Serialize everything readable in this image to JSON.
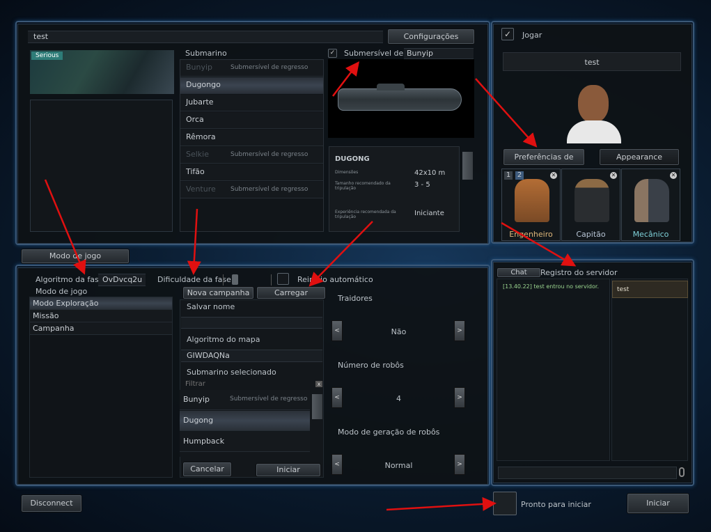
{
  "server": {
    "name": "test",
    "settings_label": "Configurações",
    "mode_badge": "Serious"
  },
  "submarine": {
    "label": "Submarino",
    "items": [
      {
        "name": "Bunyip",
        "tag": "Submersível de regresso",
        "dim": true
      },
      {
        "name": "Dugongo",
        "tag": "",
        "selected": true
      },
      {
        "name": "Jubarte",
        "tag": ""
      },
      {
        "name": "Orca",
        "tag": ""
      },
      {
        "name": "Rêmora",
        "tag": ""
      },
      {
        "name": "Selkie",
        "tag": "Submersível de regresso",
        "dim": true
      },
      {
        "name": "Tifão",
        "tag": ""
      },
      {
        "name": "Venture",
        "tag": "Submersível de regresso",
        "dim": true
      }
    ],
    "shuttle_label": "Submersível de r",
    "shuttle_value": "Bunyip",
    "info": {
      "title": "DUGONG",
      "dim_label": "Dimensões",
      "dim_value": "42x10 m",
      "crew_label": "Tamanho recomendado da tripulação",
      "crew_value": "3 - 5",
      "exp_label": "Experiência recomendada da tripulação",
      "exp_value": "Iniciante"
    }
  },
  "gamemode_tab": "Modo de jogo",
  "level": {
    "seed_label": "Algoritmo da fase",
    "seed_value": "OvDvcq2u",
    "difficulty_label": "Dificuldade da fase",
    "auto_restart_label": "Reinício automático"
  },
  "gamemode": {
    "label": "Modo de jogo",
    "items": [
      "Modo Exploração",
      "Missão",
      "Campanha"
    ],
    "selected": 0
  },
  "campaign": {
    "tabs": [
      "Nova campanha",
      "Carregar campanha"
    ],
    "save_name_label": "Salvar nome",
    "save_name_value": "",
    "map_seed_label": "Algoritmo do mapa",
    "map_seed_value": "GIWDAQNa",
    "selected_sub_label": "Submarino selecionado",
    "filter_placeholder": "Filtrar",
    "subs": [
      {
        "name": "Bunyip",
        "tag": "Submersível de regresso"
      },
      {
        "name": "Dugong",
        "tag": ""
      },
      {
        "name": "Humpback",
        "tag": ""
      }
    ],
    "cancel": "Cancelar",
    "start": "Iniciar"
  },
  "settings": [
    {
      "label": "Traidores",
      "value": "Não"
    },
    {
      "label": "Número de robôs",
      "value": "4"
    },
    {
      "label": "Modo de geração de robôs",
      "value": "Normal"
    }
  ],
  "disconnect": "Disconnect",
  "player": {
    "play_label": "Jogar",
    "name": "test",
    "tabs": [
      "Preferências de trabalho",
      "Appearance"
    ],
    "jobs": [
      {
        "name": "Engenheiro",
        "color": "#e0b87a"
      },
      {
        "name": "Capitão",
        "color": "#b7c4d4"
      },
      {
        "name": "Mecânico",
        "color": "#7fd0d8"
      }
    ],
    "priority": [
      "1",
      "2"
    ]
  },
  "chat": {
    "tabs": [
      "Chat",
      "Registro do servidor"
    ],
    "messages": [
      "[13.40.22] test entrou no servidor."
    ],
    "players": [
      "test"
    ],
    "input": ""
  },
  "ready_label": "Pronto para iniciar",
  "start_button": "Iniciar",
  "colors": {
    "annotation": "#e01010",
    "chat_text": "#9bd58f"
  }
}
